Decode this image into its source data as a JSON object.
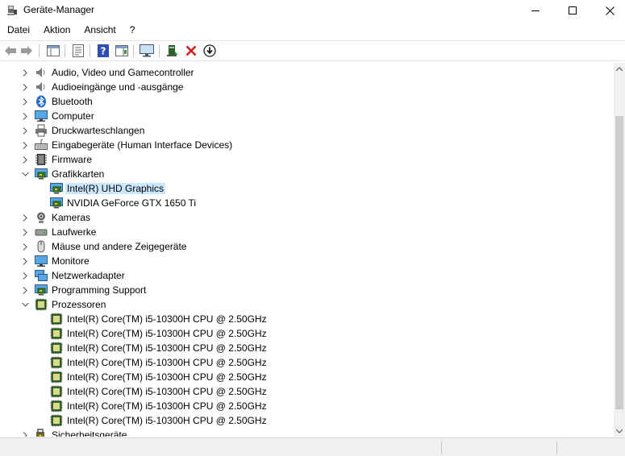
{
  "window": {
    "title": "Geräte-Manager"
  },
  "menu": [
    "Datei",
    "Aktion",
    "Ansicht",
    "?"
  ],
  "tree": [
    {
      "label": "Audio, Video und Gamecontroller",
      "level": 0,
      "state": "collapsed",
      "icon": "speaker-icon"
    },
    {
      "label": "Audioeingänge und -ausgänge",
      "level": 0,
      "state": "collapsed",
      "icon": "speaker-icon"
    },
    {
      "label": "Bluetooth",
      "level": 0,
      "state": "collapsed",
      "icon": "bluetooth-icon"
    },
    {
      "label": "Computer",
      "level": 0,
      "state": "collapsed",
      "icon": "computer-icon"
    },
    {
      "label": "Druckwarteschlangen",
      "level": 0,
      "state": "collapsed",
      "icon": "printer-icon"
    },
    {
      "label": "Eingabegeräte (Human Interface Devices)",
      "level": 0,
      "state": "collapsed",
      "icon": "keyboard-icon"
    },
    {
      "label": "Firmware",
      "level": 0,
      "state": "collapsed",
      "icon": "firmware-icon"
    },
    {
      "label": "Grafikkarten",
      "level": 0,
      "state": "expanded",
      "icon": "display-adapter-icon"
    },
    {
      "label": "Intel(R) UHD Graphics",
      "level": 1,
      "state": "none",
      "icon": "display-adapter-icon",
      "selected": true
    },
    {
      "label": "NVIDIA GeForce GTX 1650 Ti",
      "level": 1,
      "state": "none",
      "icon": "display-adapter-icon"
    },
    {
      "label": "Kameras",
      "level": 0,
      "state": "collapsed",
      "icon": "camera-icon"
    },
    {
      "label": "Laufwerke",
      "level": 0,
      "state": "collapsed",
      "icon": "drive-icon"
    },
    {
      "label": "Mäuse und andere Zeigegeräte",
      "level": 0,
      "state": "collapsed",
      "icon": "mouse-icon"
    },
    {
      "label": "Monitore",
      "level": 0,
      "state": "collapsed",
      "icon": "monitor-icon"
    },
    {
      "label": "Netzwerkadapter",
      "level": 0,
      "state": "collapsed",
      "icon": "network-icon"
    },
    {
      "label": "Programming Support",
      "level": 0,
      "state": "collapsed",
      "icon": "display-adapter-icon"
    },
    {
      "label": "Prozessoren",
      "level": 0,
      "state": "expanded",
      "icon": "cpu-icon"
    },
    {
      "label": "Intel(R) Core(TM) i5-10300H CPU @ 2.50GHz",
      "level": 1,
      "state": "none",
      "icon": "cpu-icon"
    },
    {
      "label": "Intel(R) Core(TM) i5-10300H CPU @ 2.50GHz",
      "level": 1,
      "state": "none",
      "icon": "cpu-icon"
    },
    {
      "label": "Intel(R) Core(TM) i5-10300H CPU @ 2.50GHz",
      "level": 1,
      "state": "none",
      "icon": "cpu-icon"
    },
    {
      "label": "Intel(R) Core(TM) i5-10300H CPU @ 2.50GHz",
      "level": 1,
      "state": "none",
      "icon": "cpu-icon"
    },
    {
      "label": "Intel(R) Core(TM) i5-10300H CPU @ 2.50GHz",
      "level": 1,
      "state": "none",
      "icon": "cpu-icon"
    },
    {
      "label": "Intel(R) Core(TM) i5-10300H CPU @ 2.50GHz",
      "level": 1,
      "state": "none",
      "icon": "cpu-icon"
    },
    {
      "label": "Intel(R) Core(TM) i5-10300H CPU @ 2.50GHz",
      "level": 1,
      "state": "none",
      "icon": "cpu-icon"
    },
    {
      "label": "Intel(R) Core(TM) i5-10300H CPU @ 2.50GHz",
      "level": 1,
      "state": "none",
      "icon": "cpu-icon"
    },
    {
      "label": "Sicherheitsgeräte",
      "level": 0,
      "state": "collapsed",
      "icon": "security-icon"
    }
  ],
  "colors": {
    "selection": "#cce8ff",
    "statusbar": "#f0f0f0"
  }
}
